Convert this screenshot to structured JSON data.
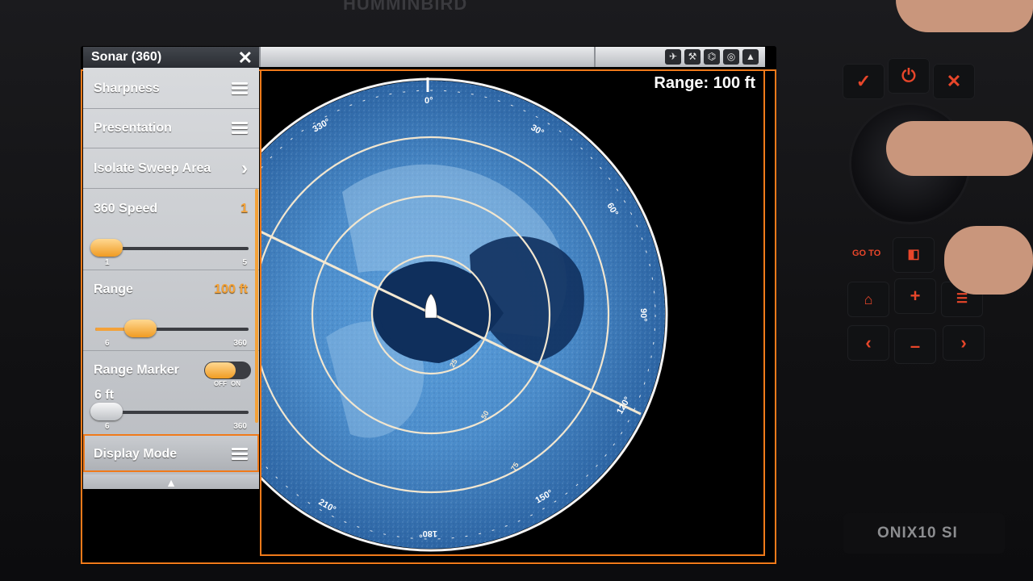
{
  "device": {
    "brand": "HUMMINBIRD",
    "model": "ONIX10 SI",
    "keypad": {
      "check": "✓",
      "power": "⏻",
      "cancel": "✕",
      "goto": "GO TO",
      "home": "⌂",
      "plus": "+",
      "menu": "☰",
      "left": "‹",
      "minus": "–",
      "right": "›"
    }
  },
  "window": {
    "title": "Sonar (360)",
    "close_label": "✕"
  },
  "status_icons": [
    "satellite-icon",
    "wrench-icon",
    "sonar-icon",
    "compass-icon",
    "navigation-icon"
  ],
  "display": {
    "range_label": "Range: 100 ft",
    "bearing_labels": [
      "0°",
      "30°",
      "60°",
      "90°",
      "120°",
      "150°",
      "180°",
      "210°",
      "330°"
    ],
    "ring_labels": [
      "25",
      "50",
      "75"
    ]
  },
  "menu": {
    "items": [
      {
        "label": "Sharpness",
        "control": "menu"
      },
      {
        "label": "Presentation",
        "control": "menu"
      },
      {
        "label": "Isolate Sweep Area",
        "control": "submenu"
      },
      {
        "label": "360 Speed",
        "value": "1"
      },
      {
        "label": "Range",
        "value": "100 ft"
      },
      {
        "label": "Range Marker"
      }
    ],
    "speed_slider": {
      "min": "1",
      "max": "5",
      "value": 0.05
    },
    "range_slider": {
      "min": "6",
      "max": "360",
      "value": 0.28
    },
    "marker_toggle": {
      "off": "OFF",
      "on": "ON",
      "state": "off"
    },
    "marker_value": "6 ft",
    "marker_slider": {
      "min": "6",
      "max": "360",
      "value": 0.0
    },
    "display_mode": "Display Mode"
  },
  "colors": {
    "accent": "#f07a1a",
    "value_orange": "#f3a23a",
    "sonar_blue": "#3d7fc0",
    "keypad_red": "#e8462a"
  }
}
